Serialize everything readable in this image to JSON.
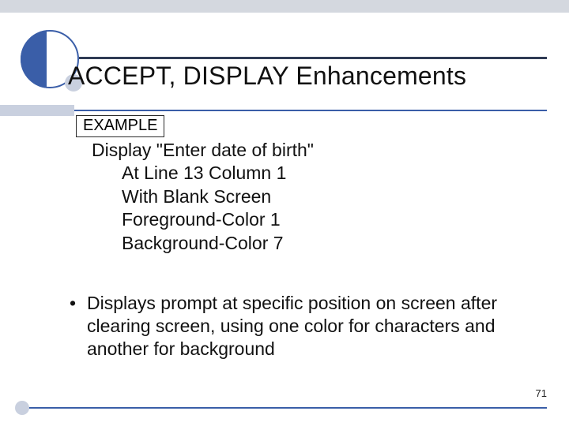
{
  "title": "ACCEPT, DISPLAY Enhancements",
  "example_label": "EXAMPLE",
  "code": {
    "l1": "Display \"Enter date of birth\"",
    "l2": "At Line 13 Column 1",
    "l3": "With Blank Screen",
    "l4": "Foreground-Color 1",
    "l5": "Background-Color 7"
  },
  "bullet": {
    "marker": "•",
    "text": "Displays prompt at specific position on screen after clearing screen, using one color for characters and another for background"
  },
  "page_number": "71"
}
